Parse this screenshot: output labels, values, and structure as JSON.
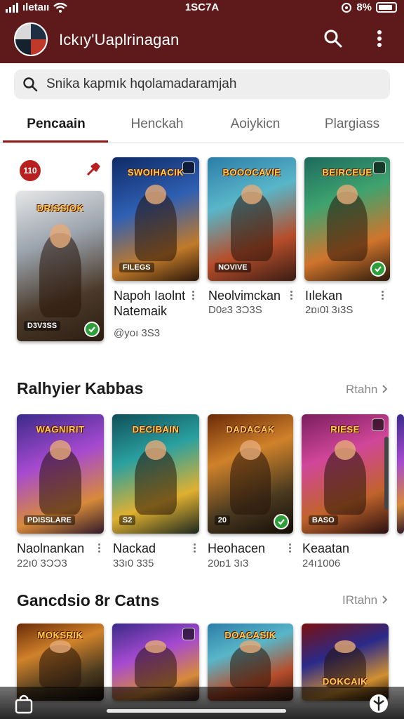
{
  "status_bar": {
    "carrier": "ıletaıı",
    "time": "1SC7A",
    "battery": "8%",
    "battery_level": 0.85
  },
  "app": {
    "title": "Ickıy'Uaplrinagan"
  },
  "search": {
    "placeholder": "Snika kapmık hqolamadaramjah"
  },
  "tabs": [
    {
      "label": "Pencaain",
      "active": true
    },
    {
      "label": "Henckah",
      "active": false
    },
    {
      "label": "Aoiykicn",
      "active": false
    },
    {
      "label": "Plargiass",
      "active": false
    }
  ],
  "featured": {
    "badge": "110",
    "cards": [
      {
        "logo": "DRISSIOK",
        "sub": "D3V3SS",
        "name": "Napoh Iaolnt Natemaik",
        "meta": "@yoı 3S3",
        "check": true,
        "theme": "slate"
      },
      {
        "logo": "SWOIHACIK",
        "sub": "FILEGS",
        "name": "",
        "meta": "",
        "check": false,
        "theme": "blue"
      },
      {
        "logo": "BOOOCAVIE",
        "sub": "NOVIVE",
        "name": "Neolvimckan",
        "meta": "D0ƨ3 3Ɔ3S",
        "check": false,
        "theme": "teal"
      },
      {
        "logo": "BEIRCEUE",
        "sub": "",
        "name": "Iılekan",
        "meta": "2ɒı0ʇ 3ı3S",
        "check": true,
        "theme": "green"
      }
    ]
  },
  "section1": {
    "title": "Ralhyier Kabbas",
    "see_all": "Rtahn",
    "cards": [
      {
        "logo": "WAGNIRIT",
        "sub": "PDISSLARE",
        "name": "Naolnankan",
        "meta": "22ı0 3ƆƆ3",
        "check": false,
        "theme": "purple"
      },
      {
        "logo": "DECIBAIN",
        "sub": "S2",
        "name": "Nackad",
        "meta": "33ı0 335",
        "check": false,
        "theme": "cyan"
      },
      {
        "logo": "DADACAK",
        "sub": "20",
        "name": "Heohacen",
        "meta": "20ɒ1 3ı3",
        "check": true,
        "theme": "amber"
      },
      {
        "logo": "RIESE",
        "sub": "BASO",
        "name": "Keaatan",
        "meta": "24ı1006",
        "check": false,
        "theme": "magenta"
      }
    ]
  },
  "section2": {
    "title": "Gancdsio 8r Catns",
    "see_all": "IRtahn",
    "cards": [
      {
        "logo": "MOKSRIK",
        "theme": "amber"
      },
      {
        "logo": "",
        "theme": "purple"
      },
      {
        "logo": "DOACASIK",
        "theme": "teal"
      },
      {
        "logo": "DOKCAIK",
        "theme": "red"
      }
    ]
  },
  "colors": {
    "appbar": "#5e1a1a",
    "accent": "#8b1a1a",
    "check": "#2e9e3a",
    "badge": "#b82020"
  },
  "icons": [
    "signal-icon",
    "wifi-icon",
    "search-icon",
    "more-vert-icon",
    "pin-icon",
    "check-icon",
    "chevron-right-icon",
    "bag-icon",
    "leaf-icon"
  ]
}
